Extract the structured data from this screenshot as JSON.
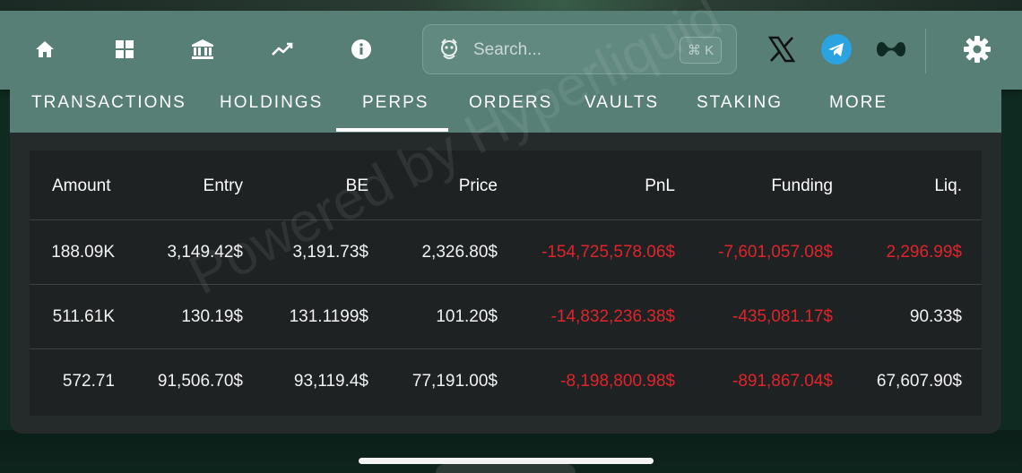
{
  "navbar": {
    "icons": [
      "home-icon",
      "dashboard-grid-icon",
      "bank-icon",
      "chart-trend-icon",
      "info-icon"
    ],
    "search": {
      "placeholder": "Search...",
      "shortcut": "⌘ K"
    },
    "socials": [
      "x-icon",
      "telegram-icon",
      "hyperliquid-icon"
    ],
    "settings_icon": "gear-icon"
  },
  "tabs": [
    {
      "label": "TRANSACTIONS"
    },
    {
      "label": "HOLDINGS"
    },
    {
      "label": "PERPS",
      "active": true
    },
    {
      "label": "ORDERS"
    },
    {
      "label": "VAULTS"
    },
    {
      "label": "STAKING"
    },
    {
      "label": "MORE"
    }
  ],
  "table": {
    "watermark": "Powered by Hyperliquid",
    "columns": [
      "Amount",
      "Entry",
      "BE",
      "Price",
      "PnL",
      "Funding",
      "Liq."
    ],
    "rows": [
      [
        "188.09K",
        "3,149.42$",
        "3,191.73$",
        "2,326.80$",
        "-154,725,578.06$",
        "-7,601,057.08$",
        "2,296.99$"
      ],
      [
        "511.61K",
        "130.19$",
        "131.1199$",
        "101.20$",
        "-14,832,236.38$",
        "-435,081.17$",
        "90.33$"
      ],
      [
        "572.71",
        "91,506.70$",
        "93,119.4$",
        "77,191.00$",
        "-8,198,800.98$",
        "-891,867.04$",
        "67,607.90$"
      ]
    ],
    "negative_color": "#e0242b",
    "liq_negative_rows": [
      true,
      false,
      false
    ]
  },
  "colors": {
    "navbar": "#577f76",
    "panel": "#252a2a",
    "table_bg": "#1e2222",
    "telegram": "#2aa3e0"
  }
}
